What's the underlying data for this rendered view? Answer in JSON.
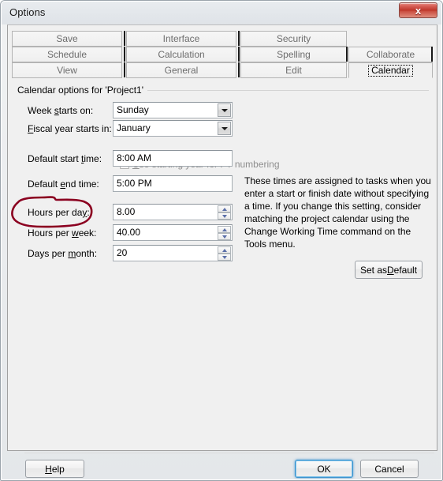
{
  "window": {
    "title": "Options",
    "close_icon": "close-x-icon",
    "close_label": "x"
  },
  "tabs": {
    "rows": [
      [
        "Save",
        "Interface",
        "Security",
        ""
      ],
      [
        "Schedule",
        "Calculation",
        "Spelling",
        "Collaborate"
      ],
      [
        "View",
        "General",
        "Edit",
        "Calendar"
      ]
    ],
    "selected": "Calendar"
  },
  "group": {
    "legend": "Calendar options for 'Project1'"
  },
  "fields": {
    "week_starts": {
      "label_pre": "Week ",
      "label_accel": "s",
      "label_post": "tarts on:",
      "value": "Sunday",
      "type": "combobox",
      "icon": "chevron-down-icon"
    },
    "fiscal_year": {
      "label_pre": "",
      "label_accel": "F",
      "label_post": "iscal year starts in:",
      "value": "January",
      "type": "combobox",
      "icon": "chevron-down-icon"
    },
    "use_starting_year": {
      "label_pre": "",
      "label_accel": "U",
      "label_post": "se starting year for FY numbering",
      "checked": false,
      "disabled": true
    },
    "default_start_time": {
      "label_pre": "Default start ",
      "label_accel": "t",
      "label_post": "ime:",
      "value": "8:00 AM",
      "type": "text"
    },
    "default_end_time": {
      "label_pre": "Default ",
      "label_accel": "e",
      "label_post": "nd time:",
      "value": "5:00 PM",
      "type": "text"
    },
    "hours_per_day": {
      "label_pre": "Hours per da",
      "label_accel": "y",
      "label_post": ":",
      "value": "8.00",
      "type": "spinner",
      "annotated": true
    },
    "hours_per_week": {
      "label_pre": "Hours per ",
      "label_accel": "w",
      "label_post": "eek:",
      "value": "40.00",
      "type": "spinner"
    },
    "days_per_month": {
      "label_pre": "Days per ",
      "label_accel": "m",
      "label_post": "onth:",
      "value": "20",
      "type": "spinner"
    }
  },
  "help": {
    "text": "These times are assigned to tasks when you enter a start or finish date without specifying a time. If you change this setting, consider matching the project calendar using the Change Working Time command on the Tools menu."
  },
  "buttons": {
    "set_as_default": {
      "pre": "Set as ",
      "accel": "D",
      "post": "efault"
    },
    "help": {
      "pre": "",
      "accel": "H",
      "post": "elp"
    },
    "ok": {
      "label": "OK"
    },
    "cancel": {
      "label": "Cancel"
    }
  },
  "annotation": {
    "shape": "hand-drawn-oval",
    "color": "#8B0020",
    "targets": "Hours per day:"
  },
  "colors": {
    "dialog_bg": "#f0f0f0",
    "accent_focus": "#3c93cf",
    "annotation_red": "#8B0020",
    "disabled_text": "#8e8e8e"
  }
}
